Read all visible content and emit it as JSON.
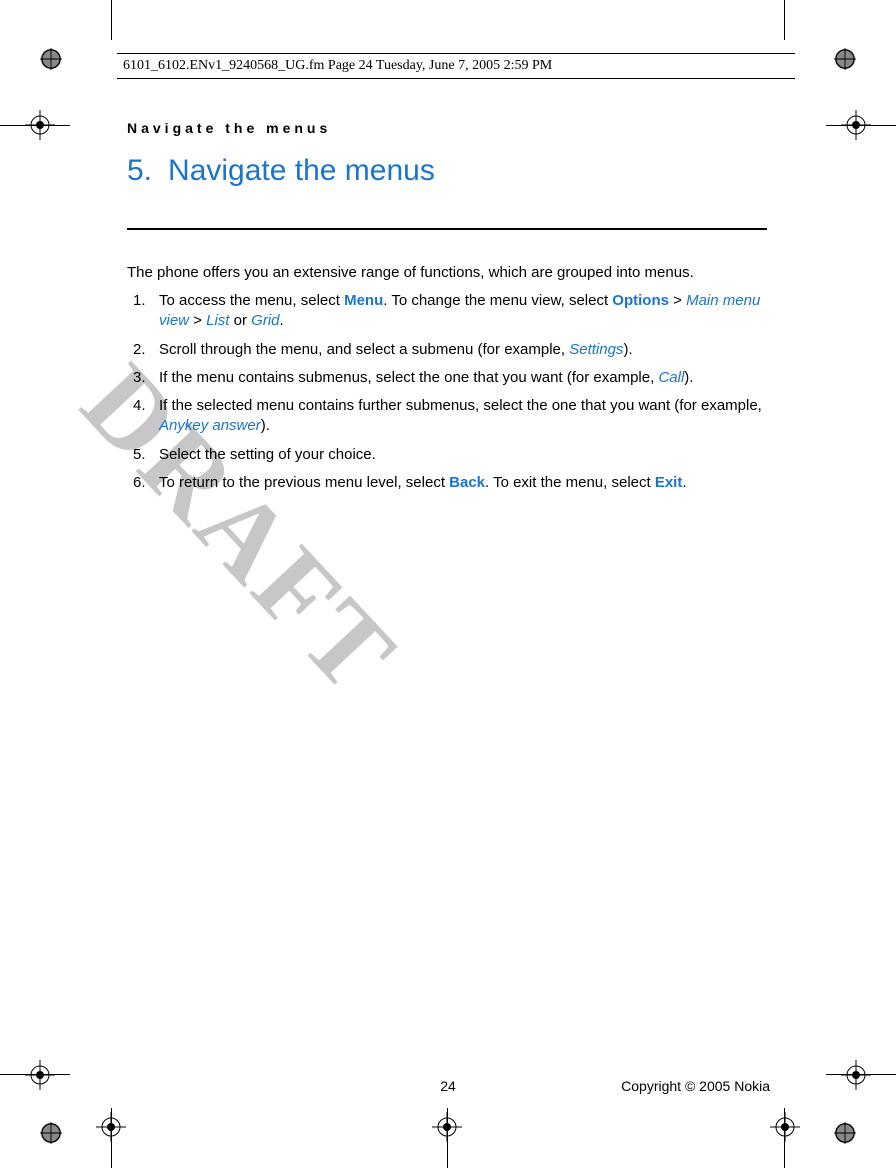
{
  "header_info": "6101_6102.ENv1_9240568_UG.fm  Page 24  Tuesday, June 7, 2005  2:59 PM",
  "running_head": "Navigate the menus",
  "chapter": {
    "num": "5.",
    "title": "Navigate the menus"
  },
  "intro": "The phone offers you an extensive range of functions, which are grouped into menus.",
  "steps": {
    "s1": {
      "a": "To access the menu, select ",
      "menu": "Menu",
      "b": ". To change the menu view, select ",
      "options": "Options",
      "gt1": " > ",
      "mmv": "Main menu view",
      "gt2": " > ",
      "list": "List",
      "or": " or ",
      "grid": "Grid",
      "end": "."
    },
    "s2": {
      "a": "Scroll through the menu, and select a submenu (for example, ",
      "settings": "Settings",
      "end": ")."
    },
    "s3": {
      "a": "If the menu contains submenus, select the one that you want (for example, ",
      "call": "Call",
      "end": ")."
    },
    "s4": {
      "a": "If the selected menu contains further submenus, select the one that you want (for example, ",
      "anykey": "Anykey answer",
      "end": ")."
    },
    "s5": {
      "a": "Select the setting of your choice."
    },
    "s6": {
      "a": "To return to the previous menu level, select ",
      "back": "Back",
      "b": ". To exit the menu, select ",
      "exit": "Exit",
      "end": "."
    }
  },
  "watermark": "DRAFT",
  "footer": {
    "page": "24",
    "copyright": "Copyright © 2005 Nokia"
  }
}
